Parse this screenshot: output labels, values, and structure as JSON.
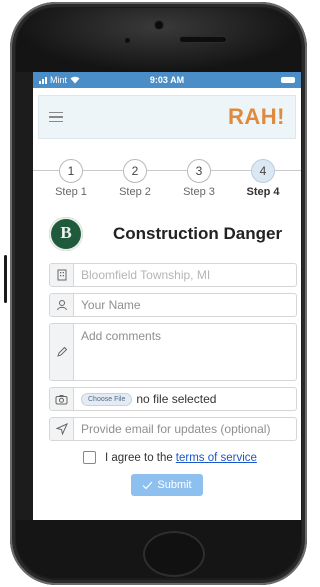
{
  "status_bar": {
    "carrier": "Mint",
    "time": "9:03 AM"
  },
  "app": {
    "logo_text": "RAH!"
  },
  "steps": [
    {
      "number": "1",
      "label": "Step 1"
    },
    {
      "number": "2",
      "label": "Step 2"
    },
    {
      "number": "3",
      "label": "Step 3"
    },
    {
      "number": "4",
      "label": "Step 4"
    }
  ],
  "form": {
    "title": "Construction Danger",
    "location_placeholder": "Bloomfield Township, MI",
    "name_placeholder": "Your Name",
    "comments_placeholder": "Add comments",
    "file_button_label": "Choose File",
    "file_status": "no file selected",
    "email_placeholder": "Provide email for updates (optional)",
    "terms_prefix": "I agree to the",
    "terms_link": "terms of service",
    "submit_label": "Submit"
  },
  "colors": {
    "status_bar": "#4b8ec7",
    "logo": "#e08a3e",
    "active_step": "#dbe7f3",
    "submit_button": "#8ec0ef",
    "link": "#1a57c9",
    "seal": "#1f5a3c"
  },
  "icons": {
    "menu": "hamburger-icon",
    "location": "building-icon",
    "name": "user-icon",
    "comments": "pencil-icon",
    "file": "camera-icon",
    "email": "send-icon",
    "submit": "checkmark-icon"
  }
}
